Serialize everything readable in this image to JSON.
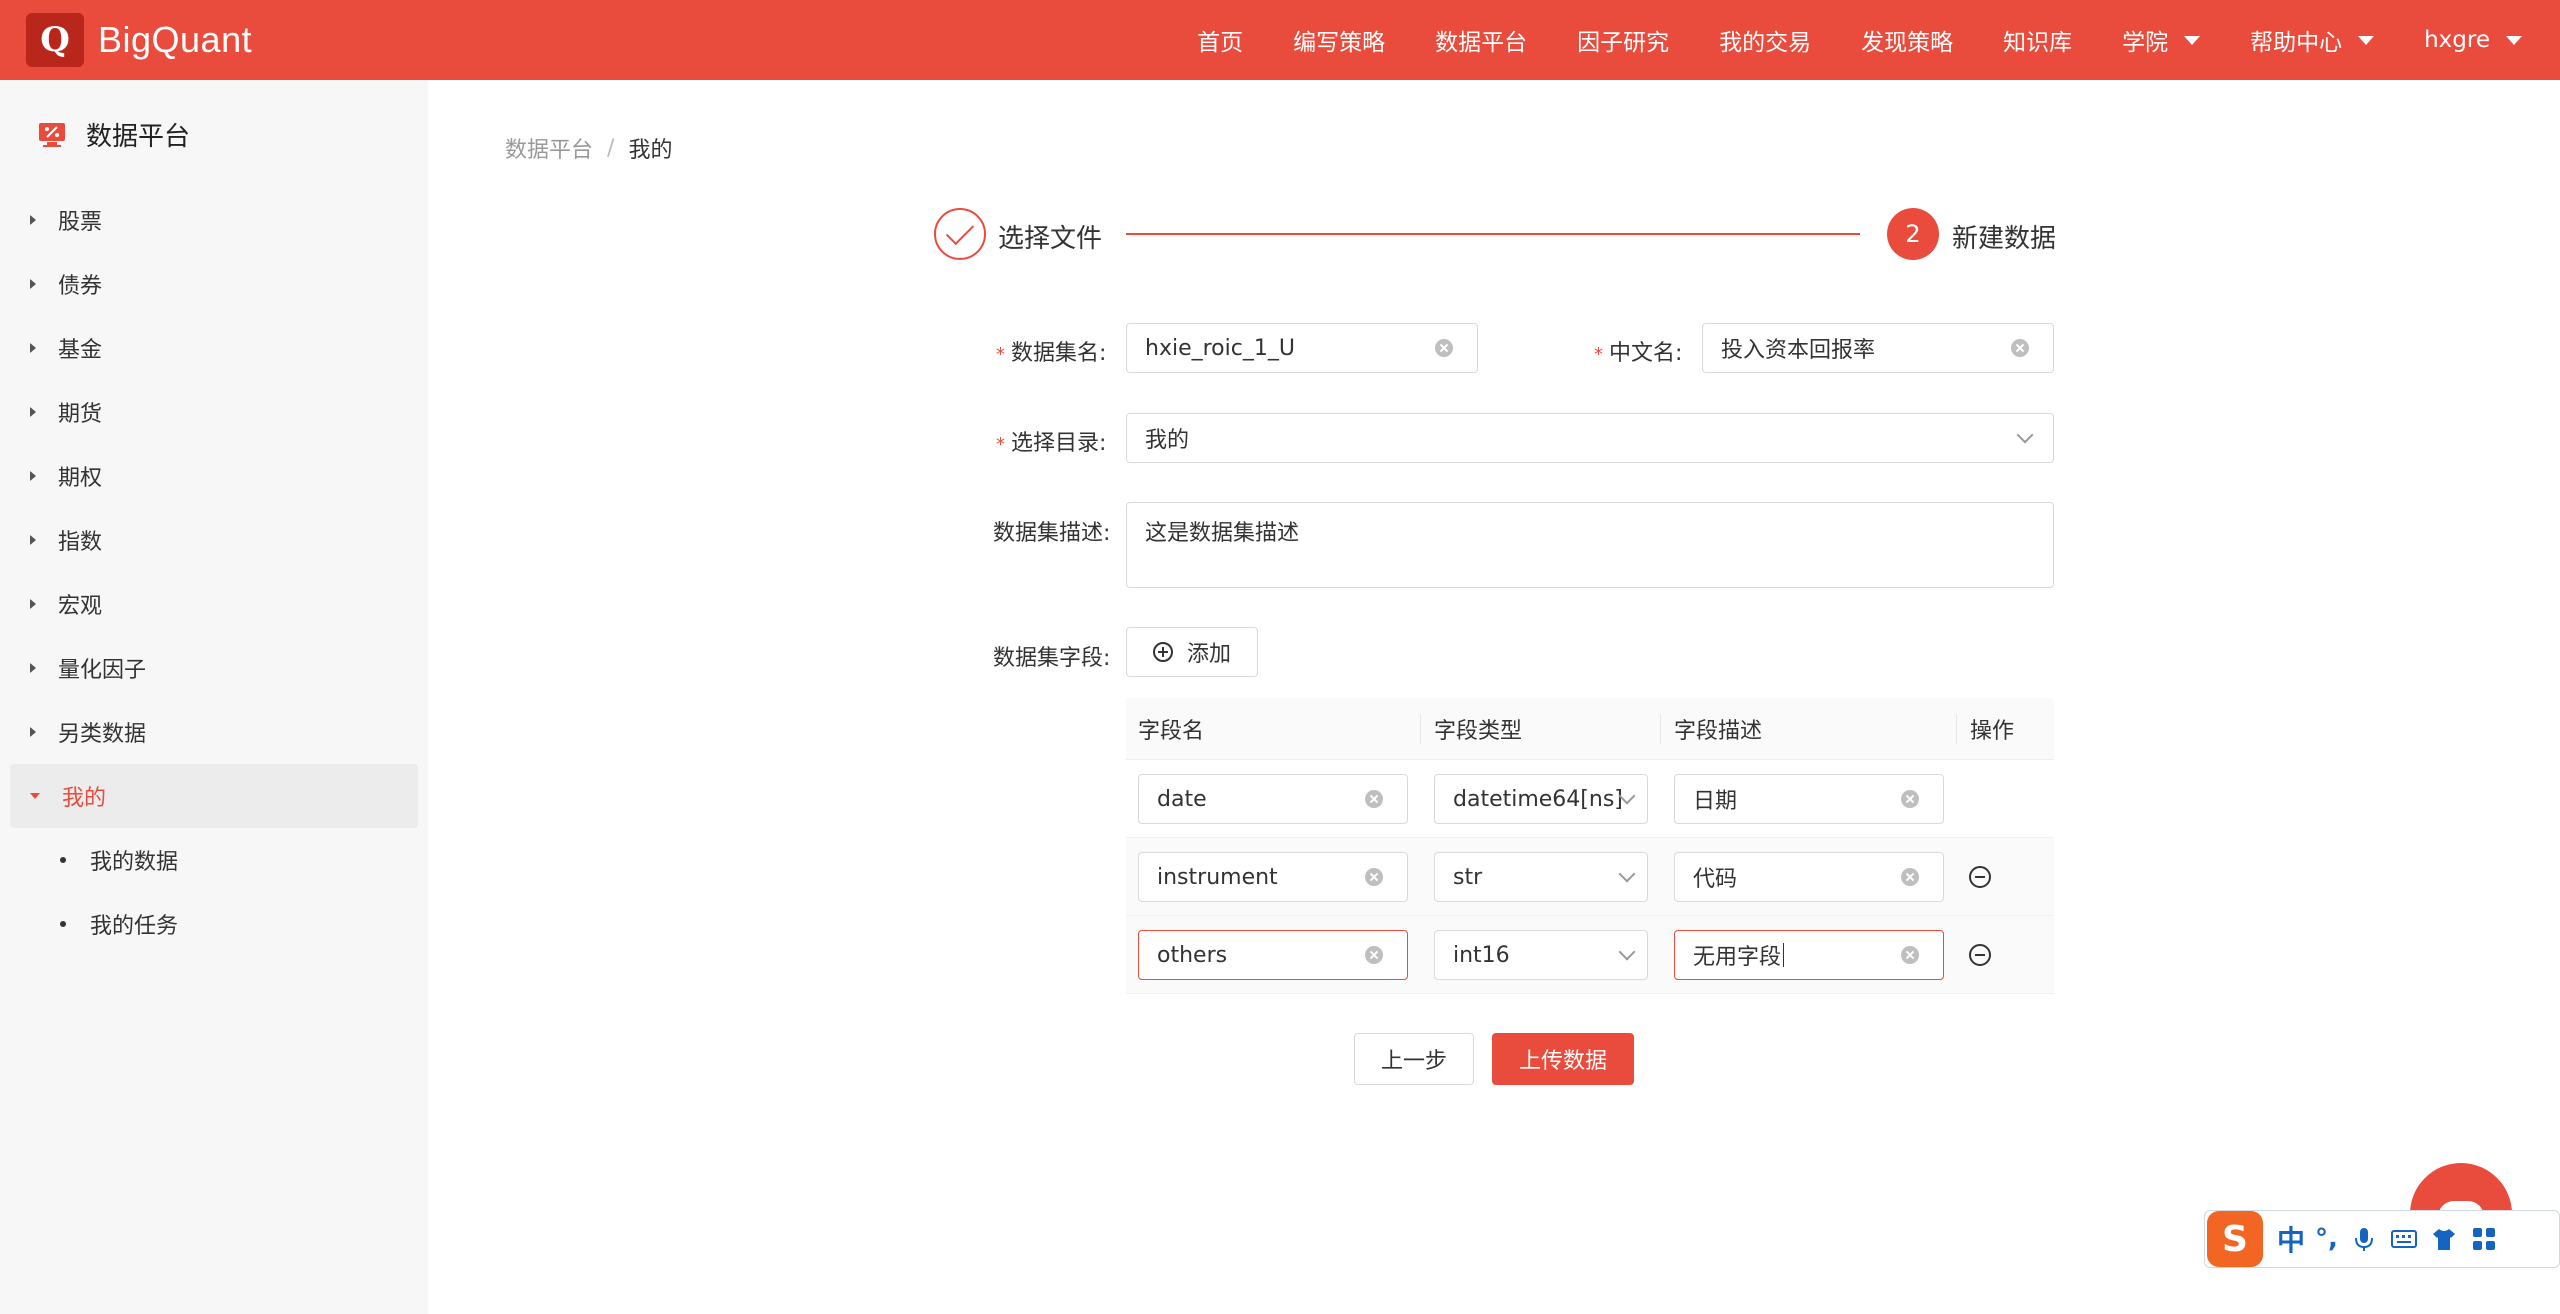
{
  "brand": {
    "logo_letter": "Q",
    "name": "BigQuant"
  },
  "nav": {
    "items": [
      "首页",
      "编写策略",
      "数据平台",
      "因子研究",
      "我的交易",
      "发现策略",
      "知识库"
    ],
    "dropdowns": [
      "学院",
      "帮助中心"
    ],
    "user": "hxgre"
  },
  "sidebar": {
    "title": "数据平台",
    "items": [
      "股票",
      "债券",
      "基金",
      "期货",
      "期权",
      "指数",
      "宏观",
      "量化因子",
      "另类数据"
    ],
    "active": "我的",
    "sub_items": [
      "我的数据",
      "我的任务"
    ]
  },
  "breadcrumb": {
    "parent": "数据平台",
    "separator": "/",
    "current": "我的"
  },
  "steps": {
    "step1": "选择文件",
    "step2_num": "2",
    "step2": "新建数据"
  },
  "form": {
    "required_mark": "*",
    "dataset_name_label": "数据集名:",
    "dataset_name": "hxie_roic_1_U",
    "cn_name_label": "中文名:",
    "cn_name": "投入资本回报率",
    "dir_label": "选择目录:",
    "dir": "我的",
    "desc_label": "数据集描述:",
    "desc": "这是数据集描述",
    "fields_label": "数据集字段:",
    "add_label": "添加"
  },
  "table": {
    "headers": [
      "字段名",
      "字段类型",
      "字段描述",
      "操作"
    ],
    "rows": [
      {
        "name": "date",
        "type": "datetime64[ns]",
        "desc": "日期"
      },
      {
        "name": "instrument",
        "type": "str",
        "desc": "代码"
      },
      {
        "name": "others",
        "type": "int16",
        "desc": "无用字段"
      }
    ]
  },
  "actions": {
    "prev": "上一步",
    "upload": "上传数据"
  },
  "ime": {
    "logo": "S",
    "mode": "中",
    "punct": "°,"
  },
  "colors": {
    "brand": "#e94b3c",
    "sidebar_bg": "#f7f7f7"
  }
}
